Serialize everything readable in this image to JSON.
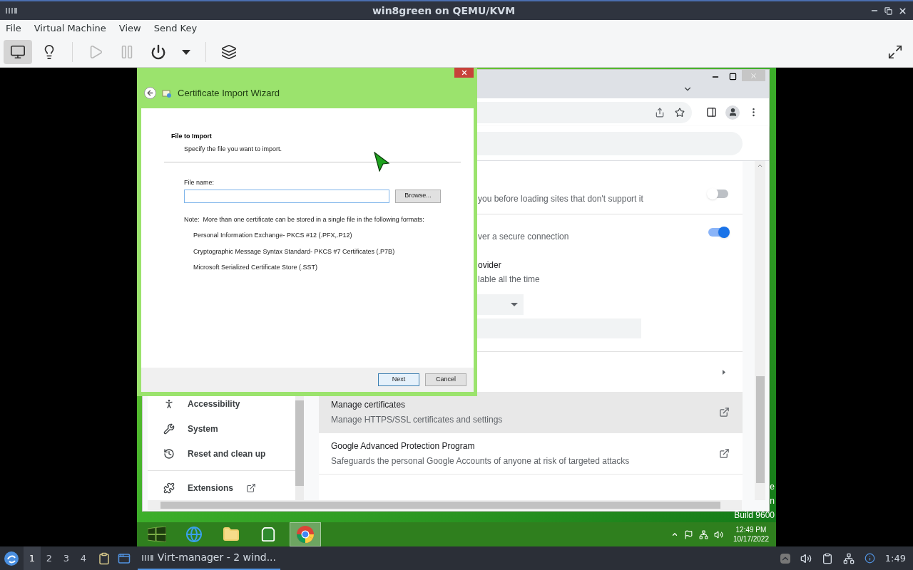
{
  "window": {
    "title": "win8green on QEMU/KVM"
  },
  "menu": [
    "File",
    "Virtual Machine",
    "View",
    "Send Key"
  ],
  "toolbar": {
    "groups": [
      [
        {
          "kind": "console",
          "selected": true,
          "disabled": false
        },
        {
          "kind": "details",
          "selected": false,
          "disabled": false
        }
      ],
      [
        {
          "kind": "run",
          "selected": false,
          "disabled": true
        },
        {
          "kind": "pause",
          "selected": false,
          "disabled": true
        },
        {
          "kind": "shutdown",
          "selected": false,
          "disabled": false
        },
        {
          "kind": "menu",
          "selected": false,
          "disabled": false
        }
      ],
      [
        {
          "kind": "snapshots",
          "selected": false,
          "disabled": false
        }
      ]
    ],
    "right": [
      {
        "kind": "fullscreen",
        "selected": false,
        "disabled": false
      }
    ]
  },
  "guest": {
    "chrome": {
      "sidebar": [
        {
          "kind": "accessibility",
          "label": "Accessibility",
          "external": false
        },
        {
          "kind": "system",
          "label": "System",
          "external": false
        },
        {
          "kind": "reset",
          "label": "Reset and clean up",
          "external": false
        },
        {
          "kind": "extensions",
          "label": "Extensions",
          "external": true
        }
      ],
      "rows": [
        {
          "kind": "toggle",
          "description": "you before loading sites that don't support it",
          "on": false
        },
        {
          "kind": "toggle",
          "description": "ver a secure connection",
          "on": true
        },
        {
          "kind": "provider",
          "title": "ovider",
          "description": "lable all the time"
        },
        {
          "kind": "nav"
        },
        {
          "kind": "external",
          "title": "Manage certificates",
          "description": "Manage HTTPS/SSL certificates and settings",
          "highlighted": true
        },
        {
          "kind": "external",
          "title": "Google Advanced Protection Program",
          "description": "Safeguards the personal Google Accounts of anyone at risk of targeted attacks",
          "highlighted": false
        }
      ]
    },
    "wizard": {
      "title": "Certificate Import Wizard",
      "heading": "File to Import",
      "subheading": "Specify the file you want to import.",
      "field_label": "File name:",
      "browse": "Browse...",
      "note": "Note:  More than one certificate can be stored in a single file in the following formats:",
      "formats": [
        "Personal Information Exchange- PKCS #12 (.PFX,.P12)",
        "Cryptographic Message Syntax Standard- PKCS #7 Certificates (.P7B)",
        "Microsoft Serialized Certificate Store (.SST)"
      ],
      "buttons": [
        {
          "label": "Next",
          "default": true
        },
        {
          "label": "Cancel",
          "default": false
        }
      ]
    },
    "desktop_text": [
      "e",
      "n",
      "Build 9600"
    ],
    "taskbar": {
      "apps": [
        {
          "kind": "start",
          "active": false
        },
        {
          "kind": "browser",
          "active": false
        },
        {
          "kind": "files",
          "active": false
        },
        {
          "kind": "store",
          "active": false
        },
        {
          "kind": "chrome",
          "active": true
        }
      ],
      "time": "12:49 PM",
      "date": "10/17/2022"
    }
  },
  "host_taskbar": {
    "workspaces": [
      {
        "label": "1",
        "selected": true
      },
      {
        "label": "2",
        "selected": false
      },
      {
        "label": "3",
        "selected": false
      },
      {
        "label": "4",
        "selected": false
      }
    ],
    "task": {
      "label": "Virt-manager - 2 wind...",
      "selected": true
    },
    "clock": "1:49"
  }
}
